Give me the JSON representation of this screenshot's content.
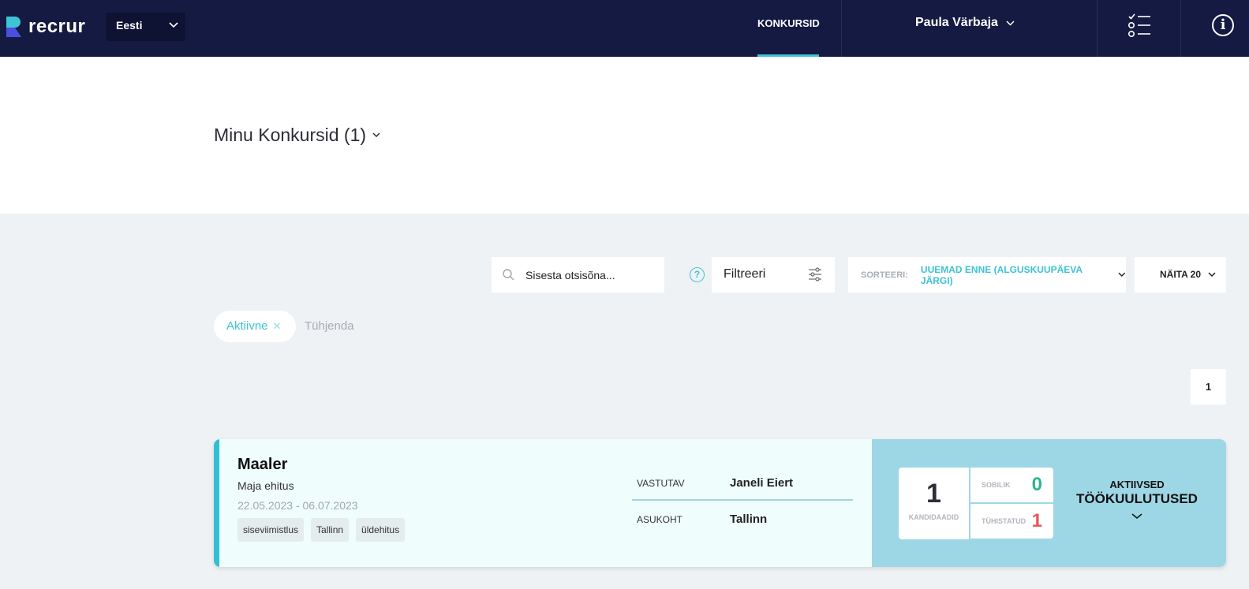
{
  "header": {
    "logo_text": "recrur",
    "language": "Eesti",
    "nav_tab": "KONKURSID",
    "user_name": "Paula Värbaja"
  },
  "page": {
    "title": "Minu Konkursid (1)"
  },
  "toolbar": {
    "search_placeholder": "Sisesta otsisõna...",
    "filter_label": "Filtreeri",
    "sort_label": "SORTEERI:",
    "sort_value": "UUEMAD ENNE (ALGUSKUUPÄEVA JÄRGI)",
    "show_label": "NÄITA 20"
  },
  "filters": {
    "active_chip": "Aktiivne",
    "clear_label": "Tühjenda"
  },
  "pagination": {
    "current_page": "1"
  },
  "jobs": [
    {
      "title": "Maaler",
      "company": "Maja ehitus",
      "dates": "22.05.2023 - 06.07.2023",
      "tags": [
        "siseviimistlus",
        "Tallinn",
        "üldehitus"
      ],
      "responsible_label": "VASTUTAV",
      "responsible": "Janeli Eiert",
      "location_label": "ASUKOHT",
      "location": "Tallinn",
      "candidates": "1",
      "candidates_label": "KANDIDAADID",
      "suitable_label": "SOBILIK",
      "suitable": "0",
      "cancelled_label": "TÜHISTATUD",
      "cancelled": "1",
      "postings_top": "AKTIIVSED",
      "postings_main": "TÖÖKUULUTUSED"
    }
  ],
  "colors": {
    "topbar": "#151a42",
    "accent": "#3ec3d5",
    "suitable": "#2bb58e",
    "cancelled": "#e05a5a",
    "stats_panel": "#9dd7e5"
  }
}
